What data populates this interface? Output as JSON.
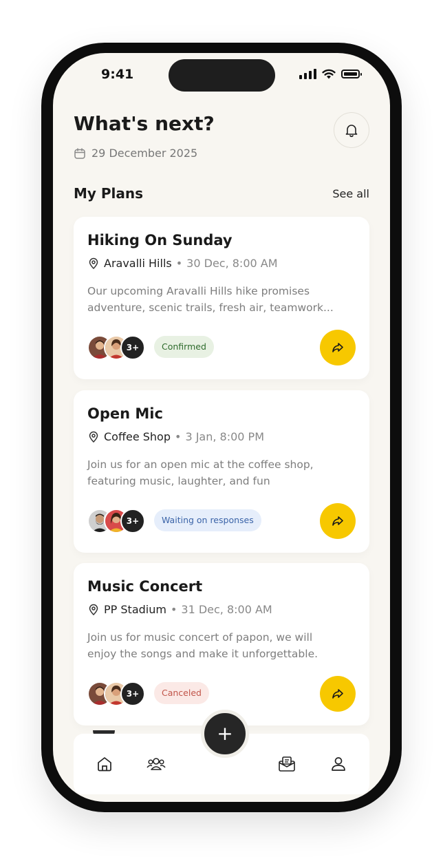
{
  "status_bar": {
    "time": "9:41"
  },
  "header": {
    "title": "What's next?",
    "date": "29 December 2025"
  },
  "section": {
    "title": "My Plans",
    "see_all": "See all"
  },
  "plans": [
    {
      "title": "Hiking On Sunday",
      "location": "Aravalli Hills",
      "when": "30 Dec, 8:00 AM",
      "description": "Our upcoming Aravalli Hills hike promises adventure, scenic trails, fresh air, teamwork...",
      "more_count": "3+",
      "status": "Confirmed",
      "status_colors": {
        "bg": "#e8f1e3",
        "fg": "#2e6b2c"
      }
    },
    {
      "title": "Open Mic",
      "location": "Coffee Shop",
      "when": "3 Jan, 8:00 PM",
      "description": "Join us for an open mic at the coffee shop, featuring music, laughter, and fun",
      "more_count": "3+",
      "status": "Waiting on responses",
      "status_colors": {
        "bg": "#e6eefb",
        "fg": "#3b64a8"
      }
    },
    {
      "title": "Music Concert",
      "location": "PP Stadium",
      "when": "31 Dec, 8:00 AM",
      "description": "Join us for music concert of papon, we will enjoy the songs and make it unforgettable.",
      "more_count": "3+",
      "status": "Canceled",
      "status_colors": {
        "bg": "#fbe9e6",
        "fg": "#c1554a"
      }
    }
  ],
  "fab": {
    "icon": "plus-icon",
    "label": "+"
  },
  "bottom_nav": {
    "items": [
      {
        "name": "home",
        "icon": "home-icon",
        "active": true
      },
      {
        "name": "friends",
        "icon": "people-icon"
      },
      {
        "name": "inbox",
        "icon": "mail-icon"
      },
      {
        "name": "profile",
        "icon": "user-icon"
      }
    ]
  },
  "colors": {
    "accent": "#f7c800",
    "background": "#f8f6f1",
    "text": "#1a1a1a",
    "muted": "#7d7d7d"
  }
}
